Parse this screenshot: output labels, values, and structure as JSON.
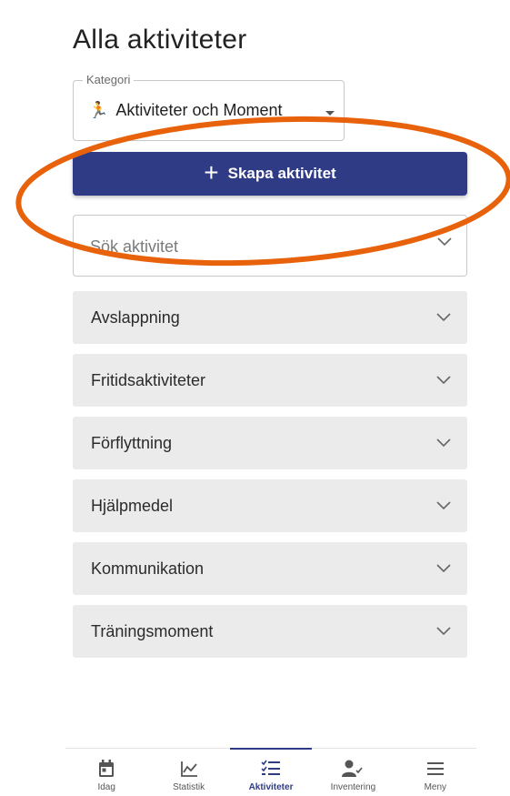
{
  "page": {
    "title": "Alla aktiviteter"
  },
  "category": {
    "label": "Kategori",
    "value": "Aktiviteter och Moment",
    "icon": "running-person-icon"
  },
  "create_button": {
    "label": "Skapa aktivitet",
    "icon": "plus-icon"
  },
  "search": {
    "placeholder": "Sök aktivitet"
  },
  "accordion": [
    {
      "label": "Avslappning"
    },
    {
      "label": "Fritidsaktiviteter"
    },
    {
      "label": "Förflyttning"
    },
    {
      "label": "Hjälpmedel"
    },
    {
      "label": "Kommunikation"
    },
    {
      "label": "Träningsmoment"
    }
  ],
  "bottom_nav": [
    {
      "label": "Idag",
      "icon": "calendar-icon",
      "active": false
    },
    {
      "label": "Statistik",
      "icon": "line-chart-icon",
      "active": false
    },
    {
      "label": "Aktiviteter",
      "icon": "checklist-icon",
      "active": true
    },
    {
      "label": "Inventering",
      "icon": "person-check-icon",
      "active": false
    },
    {
      "label": "Meny",
      "icon": "hamburger-menu-icon",
      "active": false
    }
  ],
  "colors": {
    "primary": "#303b86",
    "accordion_bg": "#ebebeb",
    "annotation": "#e8620c",
    "category_icon": "#e6a11c"
  }
}
